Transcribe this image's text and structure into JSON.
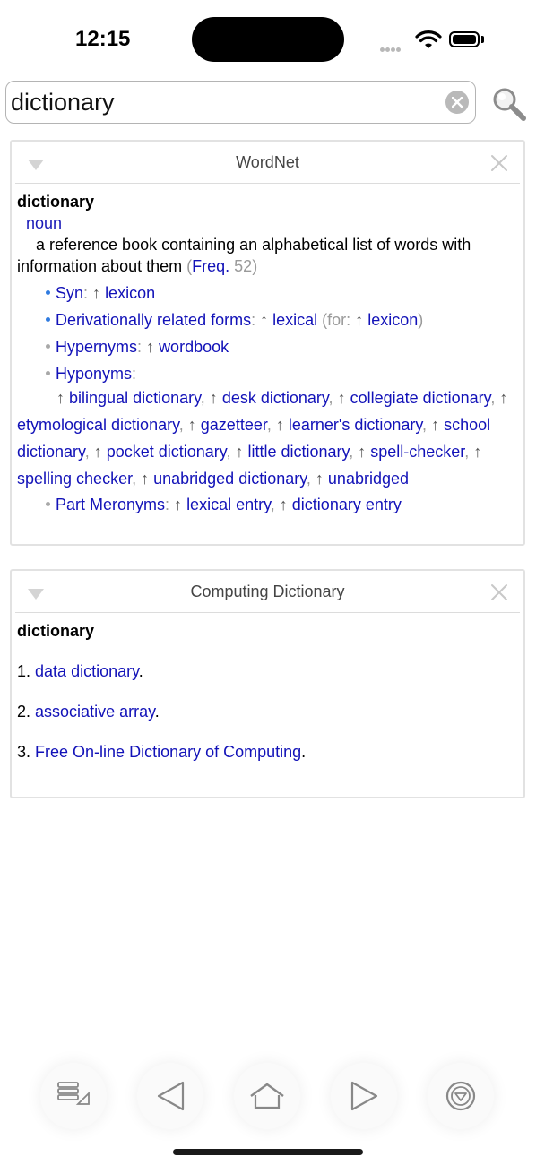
{
  "status_bar": {
    "time": "12:15"
  },
  "search": {
    "value": "dictionary"
  },
  "wordnet": {
    "title": "WordNet",
    "headword": "dictionary",
    "pos": "noun",
    "definition": "a reference book containing an alphabetical list of words with information about them",
    "freq_label": "Freq.",
    "freq_value": "52",
    "syn_label": "Syn",
    "syn_items": [
      "lexicon"
    ],
    "deriv_label": "Derivationally related forms",
    "deriv_item": "lexical",
    "deriv_for_label": "for:",
    "deriv_for_item": "lexicon",
    "hypernyms_label": "Hypernyms",
    "hypernyms_items": [
      "wordbook"
    ],
    "hyponyms_label": "Hyponyms",
    "hyponyms_items": [
      "bilingual dictionary",
      "desk dictionary",
      "collegiate dictionary",
      "etymological dictionary",
      "gazetteer",
      "learner's dictionary",
      "school dictionary",
      "pocket dictionary",
      "little dictionary",
      "spell-checker",
      "spelling checker",
      "unabridged dictionary",
      "unabridged"
    ],
    "meronyms_label": "Part Meronyms",
    "meronyms_items": [
      "lexical entry",
      "dictionary entry"
    ]
  },
  "computing": {
    "title": "Computing Dictionary",
    "headword": "dictionary",
    "items": [
      {
        "num": "1.",
        "link": "data dictionary",
        "tail": "."
      },
      {
        "num": "2.",
        "link": "associative array",
        "tail": "."
      },
      {
        "num": "3.",
        "link": "Free On-line Dictionary of Computing",
        "tail": "."
      }
    ]
  },
  "icons": {
    "list": "history-list-icon",
    "back": "back-triangle-icon",
    "home": "home-icon",
    "forward": "forward-triangle-icon",
    "menu": "circle-down-icon"
  }
}
